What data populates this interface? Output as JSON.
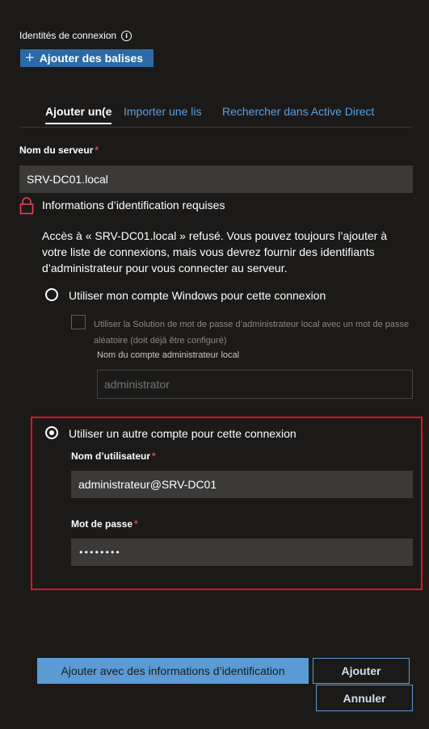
{
  "header": {
    "identities_label": "Identités de connexion",
    "info_icon": "info-icon",
    "add_tags_label": "Ajouter des balises"
  },
  "tabs": [
    {
      "label": "Ajouter un(e)"
    },
    {
      "label": "Importer une lis"
    },
    {
      "label": "Rechercher dans Active Direct"
    }
  ],
  "server": {
    "label": "Nom du serveur",
    "required_mark": "*",
    "value": "SRV-DC01.local"
  },
  "credentials": {
    "icon": "lock-icon",
    "title": "Informations d’identification requises",
    "message": "Accès à « SRV-DC01.local » refusé. Vous pouvez toujours l’ajouter à votre liste de connexions, mais vous devrez fournir des identifiants d’administrateur pour vous connecter au serveur."
  },
  "option_windows": {
    "label": "Utiliser mon compte Windows pour cette connexion",
    "laps_checkbox_label": "Utiliser la Solution de mot de passe d’administrateur local avec un mot de passe aléatoire (doit déjà être configuré)",
    "local_admin_label": "Nom du compte administrateur local",
    "local_admin_placeholder": "administrator"
  },
  "option_other": {
    "label": "Utiliser un autre compte pour cette connexion",
    "username_label": "Nom d’utilisateur",
    "username_value": "administrateur@SRV-DC01",
    "password_label": "Mot de passe",
    "password_value": "••••••••",
    "required_mark": "*"
  },
  "actions": {
    "add_with_credentials": "Ajouter avec des informations d’identification",
    "add": "Ajouter",
    "cancel": "Annuler"
  },
  "colors": {
    "background": "#1b1a19",
    "accent": "#5b9bd5",
    "required": "#e0474f",
    "highlight": "#e81123"
  }
}
